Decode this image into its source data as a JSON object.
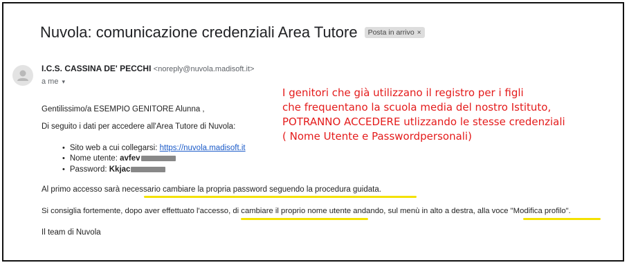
{
  "email": {
    "subject": "Nuvola: comunicazione credenziali Area Tutore",
    "label_chip": "Posta in arrivo",
    "label_chip_close": "×",
    "sender_name": "I.C.S. CASSINA DE' PECCHI",
    "sender_email": "<noreply@nuvola.madisoft.it>",
    "recipient": "a me",
    "recipient_chevron": "▾",
    "greeting": "Gentilissimo/a ESEMPIO GENITORE Alunna ,",
    "intro": "Di seguito i dati per accedere all'Area Tutore di Nuvola:",
    "site_label": "Sito web a cui collegarsi: ",
    "site_url": "https://nuvola.madisoft.it",
    "username_label": "Nome utente: ",
    "username_value": "avfev",
    "password_label": "Password: ",
    "password_value": "Kkjac",
    "first_access": "Al primo accesso sarà necessario cambiare la propria password seguendo la procedura guidata.",
    "advice": "Si consiglia fortemente, dopo aver effettuato l'accesso, di cambiare il proprio nome utente andando, sul menù in alto a destra, alla voce \"Modifica profilo\".",
    "signature": "Il team di Nuvola"
  },
  "annotation": {
    "lines": [
      "I genitori che già utilizzano il registro per i figli",
      "che frequentano la scuola media del nostro Istituto,",
      "POTRANNO ACCEDERE utlizzando le stesse credenziali",
      "( Nome Utente e Passwordpersonali)"
    ],
    "color": "#e41b1b",
    "highlight_color": "#f4e100"
  }
}
